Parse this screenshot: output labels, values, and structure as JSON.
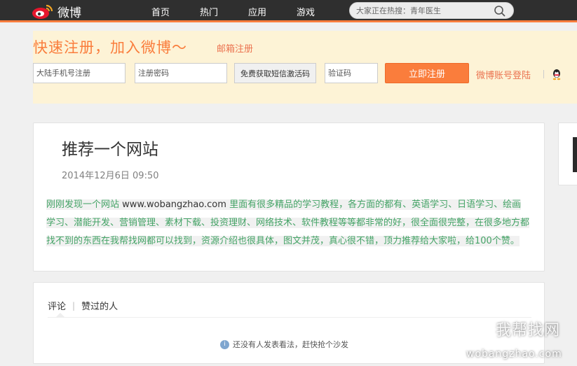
{
  "header": {
    "logo_text": "微博",
    "nav": [
      "首页",
      "热门",
      "应用",
      "游戏"
    ],
    "search_placeholder": "大家正在热搜：青年医生"
  },
  "register": {
    "title": "快速注册，加入微博～",
    "email_link": "邮箱注册",
    "phone_placeholder": "大陆手机号注册",
    "password_placeholder": "注册密码",
    "sms_button": "免费获取短信激活码",
    "code_placeholder": "验证码",
    "submit_button": "立即注册",
    "login_link": "微博账号登陆"
  },
  "article": {
    "title": "推荐一个网站",
    "date": "2014年12月6日 09:50",
    "body_prefix": "刚刚发现一个网站 ",
    "body_url": "www.wobangzhao.com",
    "body_rest": " 里面有很多精品的学习教程，各方面的都有、英语学习、日语学习、绘画学习、潜能开发、营销管理、素材下载、投资理财、网络技术、软件教程等等都非常的好，很全面很完整，在很多地方都找不到的东西在我帮找网都可以找到，资源介绍也很具体，图文并茂，真心很不错，顶力推荐给大家啦，给100个赞。"
  },
  "comments": {
    "tab_comments": "评论",
    "tab_separator": "|",
    "tab_likers": "赞过的人",
    "empty_text": "还没有人发表看法，赶快抢个沙发"
  },
  "watermark": {
    "cn": "我帮找网",
    "en": "wobangzhao.com"
  },
  "colors": {
    "accent": "#fa7d3c",
    "topbar": "#2f2f2f",
    "body_text_green": "#44a366",
    "register_bg": "#fdf3d6"
  }
}
